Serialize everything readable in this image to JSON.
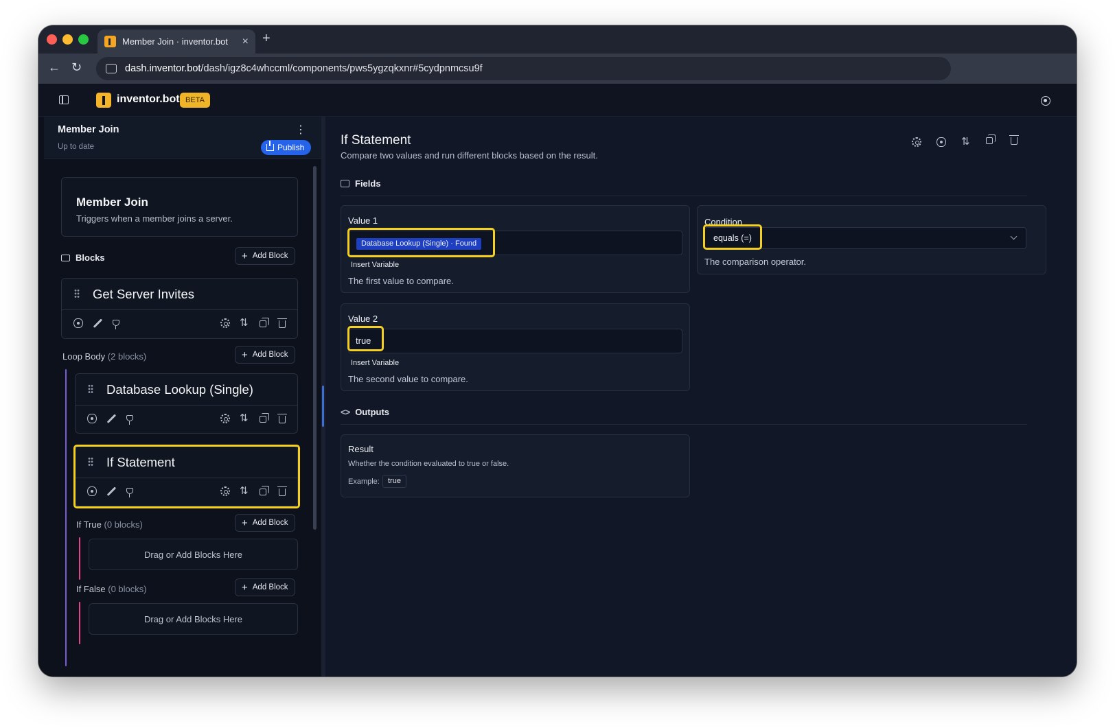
{
  "browser": {
    "tab_title": "Member Join · inventor.bot",
    "url_host": "dash.inventor.bot",
    "url_path": "/dash/igz8c4whccml/components/pws5ygzqkxnr#5cydpnmcsu9f"
  },
  "app": {
    "brand": "inventor.bot",
    "badge": "BETA"
  },
  "left_panel": {
    "title": "Member Join",
    "status": "Up to date",
    "publish_label": "Publish",
    "trigger": {
      "title": "Member Join",
      "description": "Triggers when a member joins a server."
    },
    "blocks_label": "Blocks",
    "add_block_label": "Add Block",
    "blocks": [
      {
        "title": "Get Server Invites"
      },
      {
        "title": "Database Lookup (Single)"
      },
      {
        "title": "If Statement"
      }
    ],
    "loop_body": {
      "label": "Loop Body",
      "count": "(2 blocks)"
    },
    "if_true": {
      "label": "If True",
      "count": "(0 blocks)"
    },
    "if_false": {
      "label": "If False",
      "count": "(0 blocks)"
    },
    "dropzone_label": "Drag or Add Blocks Here"
  },
  "right_panel": {
    "title": "If Statement",
    "description": "Compare two values and run different blocks based on the result.",
    "fields_label": "Fields",
    "outputs_label": "Outputs",
    "value1": {
      "label": "Value 1",
      "chip": "Database Lookup (Single) · Found",
      "insert_variable": "Insert Variable",
      "help": "The first value to compare."
    },
    "value2": {
      "label": "Value 2",
      "value": "true",
      "insert_variable": "Insert Variable",
      "help": "The second value to compare."
    },
    "condition": {
      "label": "Condition",
      "selected": "equals (=)",
      "help": "The comparison operator."
    },
    "result": {
      "label": "Result",
      "description": "Whether the condition evaluated to true or false.",
      "example_label": "Example:",
      "example_value": "true"
    }
  },
  "colors": {
    "accent_blue": "#2563eb",
    "highlight_yellow": "#f5d020",
    "loop_line": "#7c5cd6",
    "branch_line": "#e0468a",
    "beta_badge": "#f0b429"
  },
  "icons": [
    "sidebar-toggle-icon",
    "help-icon",
    "kebab-icon",
    "upload-icon",
    "folder-icon",
    "drag-handle-icon",
    "eye-icon",
    "pencil-icon",
    "plug-icon",
    "gear-icon",
    "sort-icon",
    "copy-icon",
    "trash-icon",
    "fields-icon",
    "code-icon",
    "chevron-down-icon"
  ]
}
